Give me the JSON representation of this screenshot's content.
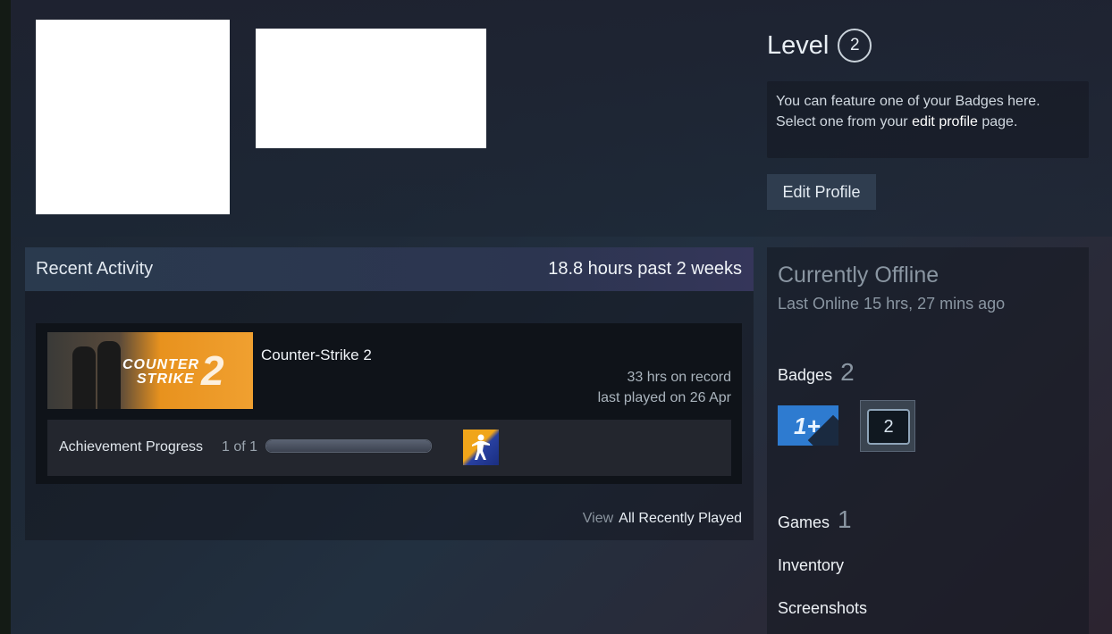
{
  "profile": {
    "level_label": "Level",
    "level_value": "2",
    "badge_feature_line1": "You can feature one of your Badges here.",
    "badge_feature_line2_pre": "Select one from your ",
    "badge_feature_link": "edit profile",
    "badge_feature_line2_post": " page.",
    "edit_profile_label": "Edit Profile"
  },
  "recent_activity": {
    "title": "Recent Activity",
    "hours_summary": "18.8 hours past 2 weeks",
    "game": {
      "name": "Counter-Strike 2",
      "hours_on_record": "33 hrs on record",
      "last_played": "last played on 26 Apr",
      "thumbnail_text_1": "COUNTER",
      "thumbnail_text_2": "STRIKE",
      "thumbnail_text_3": "2",
      "achievement_label": "Achievement Progress",
      "achievement_count": "1 of 1",
      "achievement_progress": 1.0
    },
    "view_word": "View",
    "view_link": "All Recently Played"
  },
  "sidebar": {
    "status": "Currently Offline",
    "last_online": "Last Online 15 hrs, 27 mins ago",
    "badges_label": "Badges",
    "badges_count": "2",
    "badge1_text": "1+",
    "badge2_text": "2",
    "games_label": "Games",
    "games_count": "1",
    "inventory_label": "Inventory",
    "screenshots_label": "Screenshots"
  }
}
